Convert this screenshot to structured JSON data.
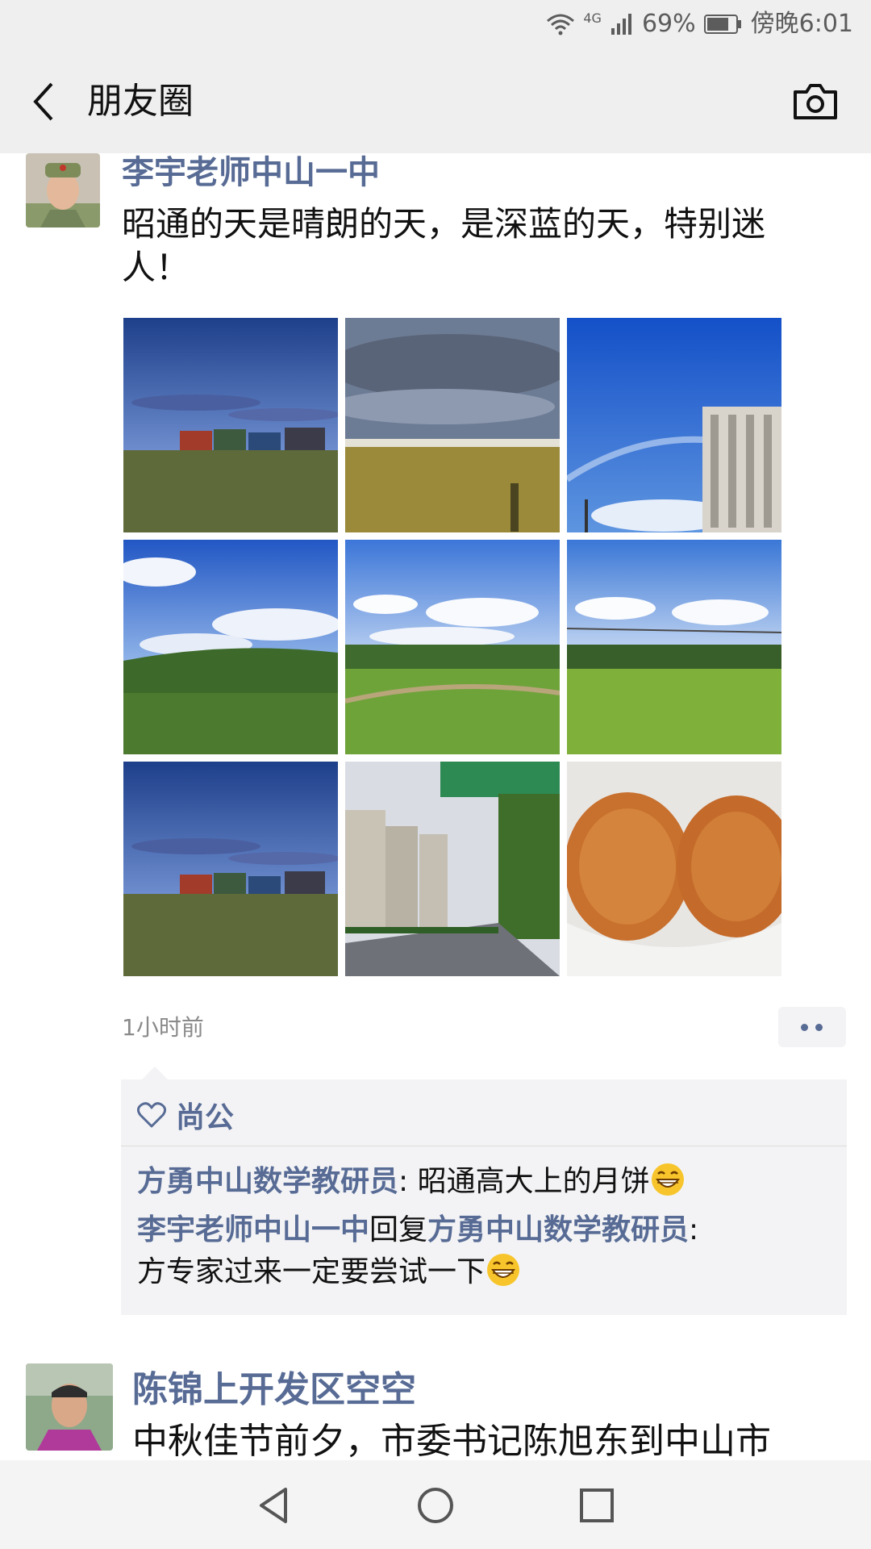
{
  "status_bar": {
    "network": "4G",
    "battery": "69%",
    "time": "傍晚6:01"
  },
  "nav": {
    "title": "朋友圈"
  },
  "post1": {
    "user": "李宇老师中山一中",
    "text_line1": "昭通的天是晴朗的天，是深蓝的天，特别迷",
    "text_line2": "人！",
    "time": "1小时前",
    "likes": [
      "尚公"
    ],
    "comments": [
      {
        "author": "方勇中山数学教研员",
        "sep": ": ",
        "text": "昭通高大上的月饼"
      },
      {
        "author": "李宇老师中山一中",
        "reply_word": "回复",
        "reply_to": "方勇中山数学教研员",
        "sep": ":",
        "text": "方专家过来一定要尝试一下"
      }
    ]
  },
  "post2": {
    "user": "陈锦上开发区空空",
    "text": "中秋佳节前夕，市委书记陈旭东到中山市"
  },
  "colors": {
    "name_blue": "#576b95",
    "bar_gray": "#efefef"
  }
}
